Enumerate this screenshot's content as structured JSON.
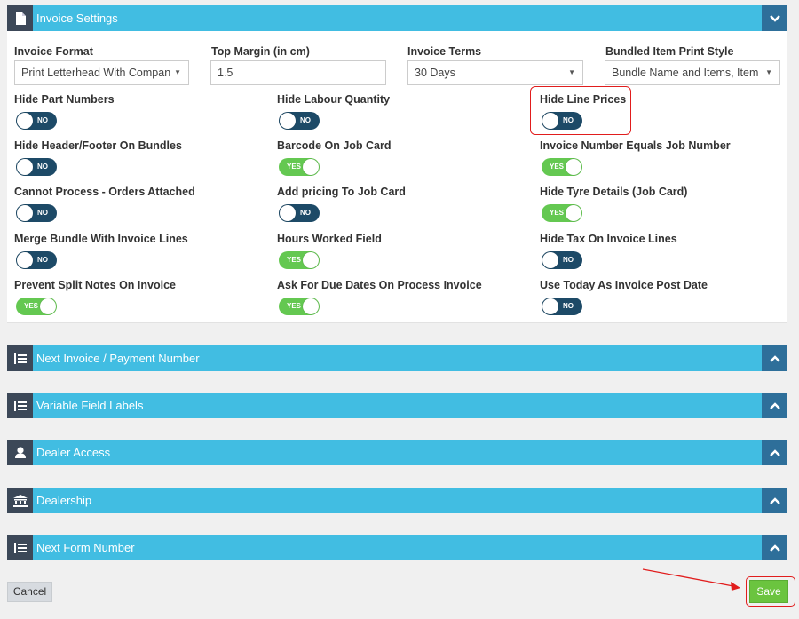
{
  "invoice_settings": {
    "title": "Invoice Settings",
    "fields": {
      "invoice_format": {
        "label": "Invoice Format",
        "value": "Print Letterhead With Compan"
      },
      "top_margin": {
        "label": "Top Margin (in cm)",
        "value": "1.5"
      },
      "invoice_terms": {
        "label": "Invoice Terms",
        "value": "30 Days"
      },
      "bundled_print_style": {
        "label": "Bundled Item Print Style",
        "value": "Bundle Name and Items, Item"
      }
    },
    "toggles": [
      {
        "label": "Hide Part Numbers",
        "state": "NO"
      },
      {
        "label": "Hide Labour Quantity",
        "state": "NO"
      },
      {
        "label": "Hide Line Prices",
        "state": "NO"
      },
      {
        "label": "Hide Header/Footer On Bundles",
        "state": "NO"
      },
      {
        "label": "Barcode On Job Card",
        "state": "YES"
      },
      {
        "label": "Invoice Number Equals Job Number",
        "state": "YES"
      },
      {
        "label": "Cannot Process - Orders Attached",
        "state": "NO"
      },
      {
        "label": "Add pricing To Job Card",
        "state": "NO"
      },
      {
        "label": "Hide Tyre Details (Job Card)",
        "state": "YES"
      },
      {
        "label": "Merge Bundle With Invoice Lines",
        "state": "NO"
      },
      {
        "label": "Hours Worked Field",
        "state": "YES"
      },
      {
        "label": "Hide Tax On Invoice Lines",
        "state": "NO"
      },
      {
        "label": "Prevent Split Notes On Invoice",
        "state": "YES"
      },
      {
        "label": "Ask For Due Dates On Process Invoice",
        "state": "YES"
      },
      {
        "label": "Use Today As Invoice Post Date",
        "state": "NO"
      }
    ]
  },
  "sections": [
    {
      "title": "Next Invoice / Payment Number",
      "icon": "list-icon"
    },
    {
      "title": "Variable Field Labels",
      "icon": "list-icon"
    },
    {
      "title": "Dealer Access",
      "icon": "user-icon"
    },
    {
      "title": "Dealership",
      "icon": "bank-icon"
    },
    {
      "title": "Next Form Number",
      "icon": "list-icon"
    }
  ],
  "actions": {
    "cancel": "Cancel",
    "save": "Save"
  },
  "colors": {
    "header_bg": "#41bde2",
    "icon_box": "#3c4858",
    "toggle_box": "#2e6f9a",
    "switch_no": "#1d4a67",
    "switch_yes": "#64c851",
    "save": "#6bc43f",
    "annotation": "#e11d1d"
  }
}
